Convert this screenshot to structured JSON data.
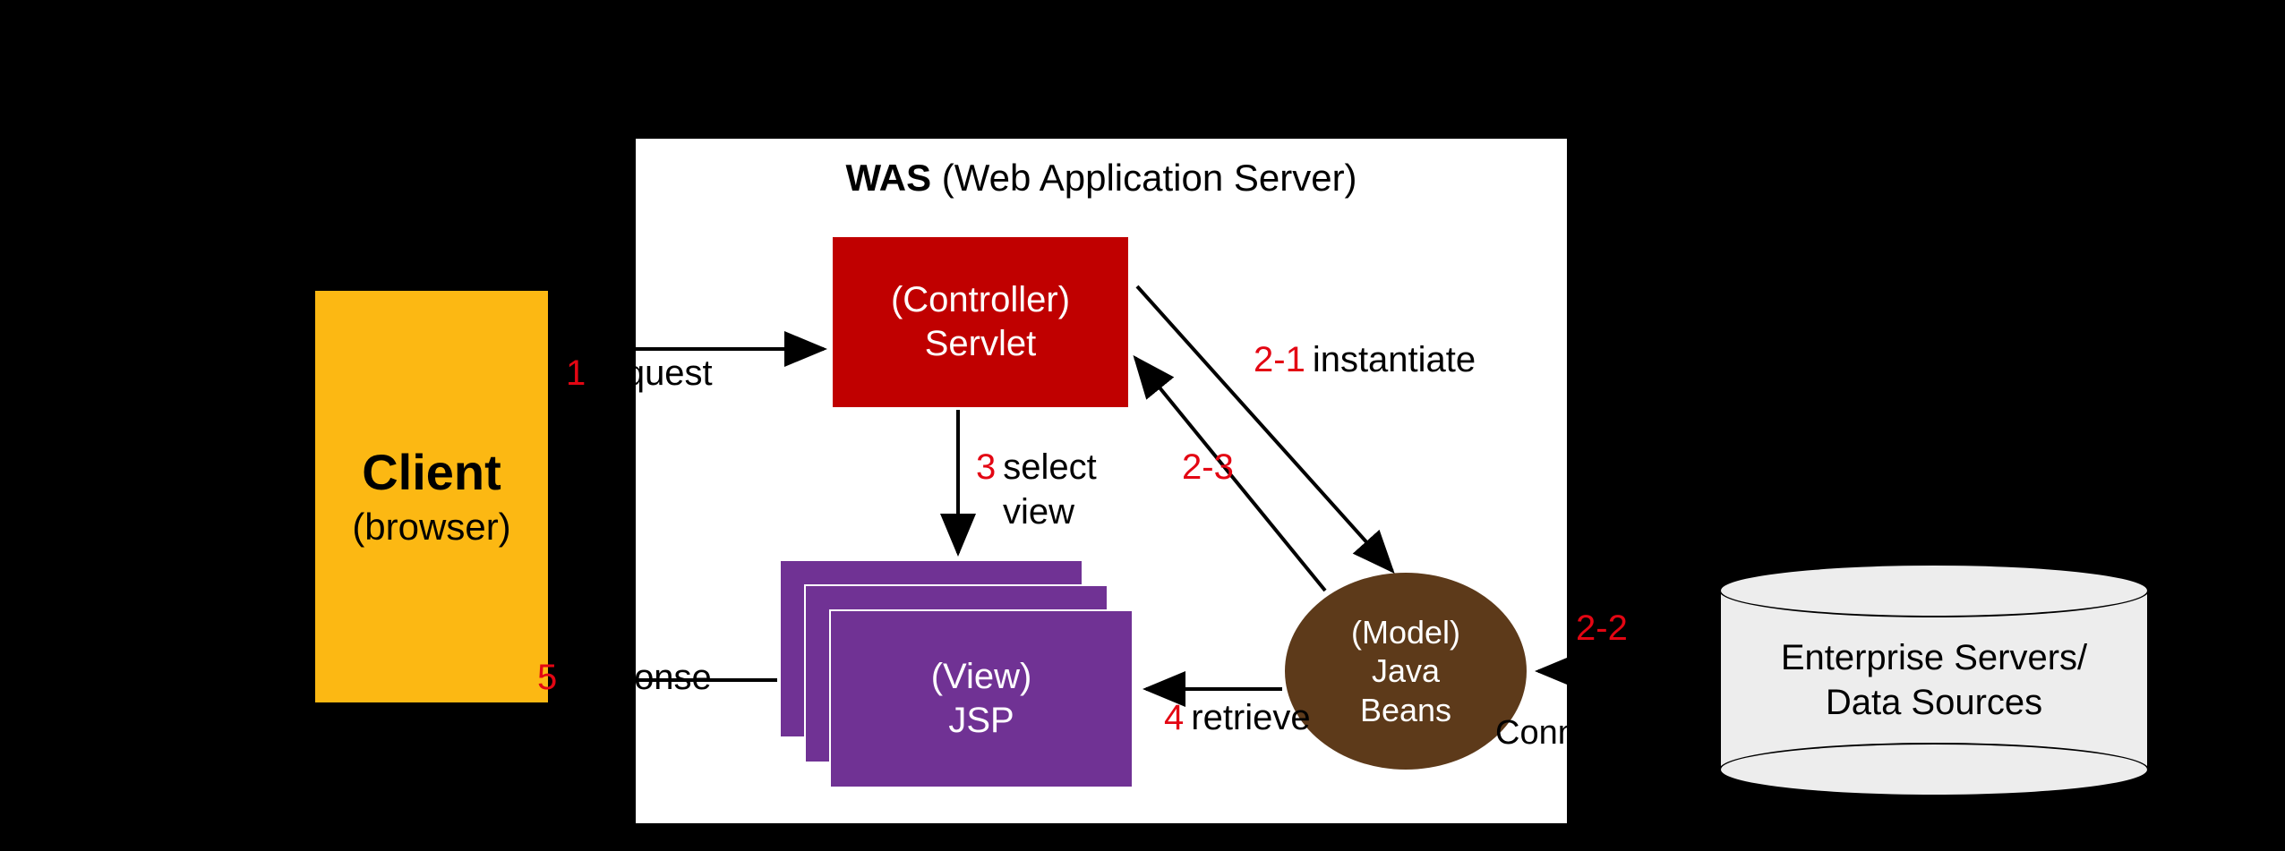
{
  "client": {
    "title": "Client",
    "sub": "(browser)"
  },
  "was": {
    "bold": "WAS",
    "thin": " (Web Application Server)"
  },
  "controller": {
    "l1": "(Controller)",
    "l2": "Servlet"
  },
  "view": {
    "l1": "(View)",
    "l2": "JSP"
  },
  "model": {
    "l1": "(Model)",
    "l2": "Java",
    "l3": "Beans"
  },
  "datasource": {
    "l1": "Enterprise Servers/",
    "l2": "Data Sources"
  },
  "labels": {
    "s1": {
      "num": "1",
      "text": "request"
    },
    "s2_1": {
      "num": "2-1",
      "text": "instantiate"
    },
    "s2_2": {
      "num": "2-2",
      "text": ""
    },
    "s2_2b": {
      "text": "Connection"
    },
    "s2_3": {
      "num": "2-3",
      "text": ""
    },
    "s3a": {
      "num": "3",
      "text": "select"
    },
    "s3b": {
      "text": "view"
    },
    "s4": {
      "num": "4",
      "text": "retrieve"
    },
    "s5": {
      "num": "5",
      "text": "response"
    }
  }
}
